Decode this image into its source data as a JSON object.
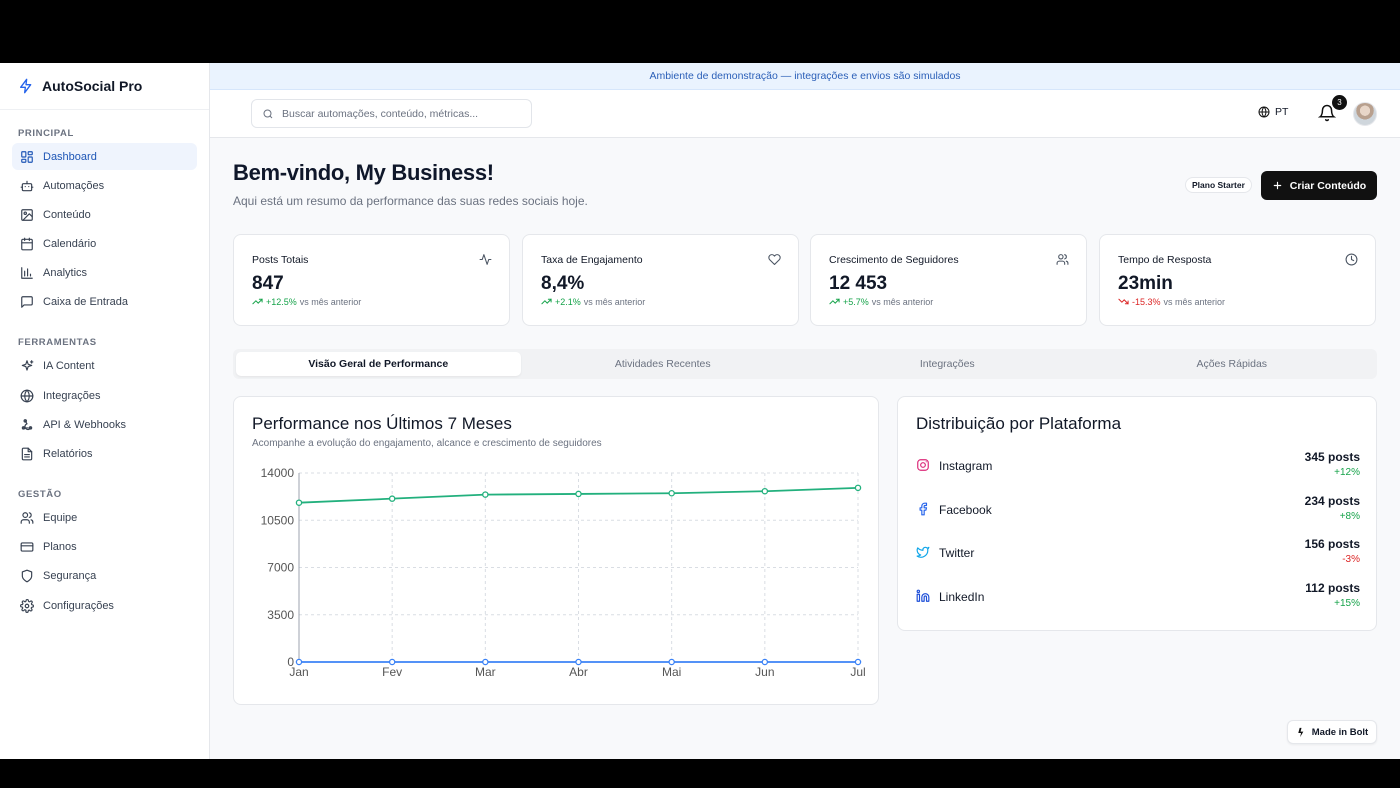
{
  "brand": {
    "name": "AutoSocial Pro"
  },
  "sidebar": {
    "sections": [
      {
        "heading": "PRINCIPAL",
        "items": [
          {
            "label": "Dashboard",
            "icon": "dashboard-icon",
            "active": true
          },
          {
            "label": "Automações",
            "icon": "robot-icon"
          },
          {
            "label": "Conteúdo",
            "icon": "image-icon"
          },
          {
            "label": "Calendário",
            "icon": "calendar-icon"
          },
          {
            "label": "Analytics",
            "icon": "bar-chart-icon"
          },
          {
            "label": "Caixa de Entrada",
            "icon": "message-icon"
          }
        ]
      },
      {
        "heading": "FERRAMENTAS",
        "items": [
          {
            "label": "IA Content",
            "icon": "sparkles-icon"
          },
          {
            "label": "Integrações",
            "icon": "globe-icon"
          },
          {
            "label": "API & Webhooks",
            "icon": "webhook-icon"
          },
          {
            "label": "Relatórios",
            "icon": "file-text-icon"
          }
        ]
      },
      {
        "heading": "GESTÃO",
        "items": [
          {
            "label": "Equipe",
            "icon": "users-icon"
          },
          {
            "label": "Planos",
            "icon": "credit-card-icon"
          },
          {
            "label": "Segurança",
            "icon": "shield-icon"
          },
          {
            "label": "Configurações",
            "icon": "gear-icon"
          }
        ]
      }
    ]
  },
  "banner": {
    "text": "Ambiente de demonstração — integrações e envios são simulados"
  },
  "header": {
    "search_placeholder": "Buscar automações, conteúdo, métricas...",
    "language": "PT",
    "notifications": "3"
  },
  "welcome": {
    "title": "Bem-vindo, My Business!",
    "subtitle": "Aqui está um resumo da performance das suas redes sociais hoje.",
    "plan": "Plano Starter",
    "create_label": "Criar Conteúdo"
  },
  "stats": [
    {
      "label": "Posts Totais",
      "value": "847",
      "change": "+12.5%",
      "trend": "up",
      "suffix": "vs mês anterior",
      "icon": "activity-icon"
    },
    {
      "label": "Taxa de Engajamento",
      "value": "8,4%",
      "change": "+2.1%",
      "trend": "up",
      "suffix": "vs mês anterior",
      "icon": "heart-icon"
    },
    {
      "label": "Crescimento de Seguidores",
      "value": "12 453",
      "change": "+5.7%",
      "trend": "up",
      "suffix": "vs mês anterior",
      "icon": "users-icon"
    },
    {
      "label": "Tempo de Resposta",
      "value": "23min",
      "change": "-15.3%",
      "trend": "down",
      "suffix": "vs mês anterior",
      "icon": "clock-icon"
    }
  ],
  "tabs": [
    {
      "label": "Visão Geral de Performance",
      "active": true
    },
    {
      "label": "Atividades Recentes"
    },
    {
      "label": "Integrações"
    },
    {
      "label": "Ações Rápidas"
    }
  ],
  "performance": {
    "title": "Performance nos Últimos 7 Meses",
    "subtitle": "Acompanhe a evolução do engajamento, alcance e crescimento de seguidores"
  },
  "chart_data": {
    "type": "line",
    "x": [
      "Jan",
      "Fev",
      "Mar",
      "Abr",
      "Mai",
      "Jun",
      "Jul"
    ],
    "yticks": [
      0,
      3500,
      7000,
      10500,
      14000
    ],
    "ylim": [
      0,
      14000
    ],
    "grid": true,
    "series": [
      {
        "color": "#22b07d",
        "values": [
          11800,
          12100,
          12400,
          12450,
          12500,
          12650,
          12900
        ]
      },
      {
        "color": "#3b82f6",
        "values": [
          0,
          0,
          0,
          0,
          0,
          0,
          0
        ]
      }
    ]
  },
  "distribution": {
    "title": "Distribuição por Plataforma",
    "platforms": [
      {
        "name": "Instagram",
        "posts": "345 posts",
        "growth": "+12%",
        "trend": "up",
        "icon": "instagram-icon",
        "color": "#db2777"
      },
      {
        "name": "Facebook",
        "posts": "234 posts",
        "growth": "+8%",
        "trend": "up",
        "icon": "facebook-icon",
        "color": "#2563eb"
      },
      {
        "name": "Twitter",
        "posts": "156 posts",
        "growth": "-3%",
        "trend": "down",
        "icon": "twitter-icon",
        "color": "#0ea5e9"
      },
      {
        "name": "LinkedIn",
        "posts": "112 posts",
        "growth": "+15%",
        "trend": "up",
        "icon": "linkedin-icon",
        "color": "#1d4ed8"
      }
    ]
  },
  "bolt_badge": {
    "label": "Made in Bolt"
  }
}
